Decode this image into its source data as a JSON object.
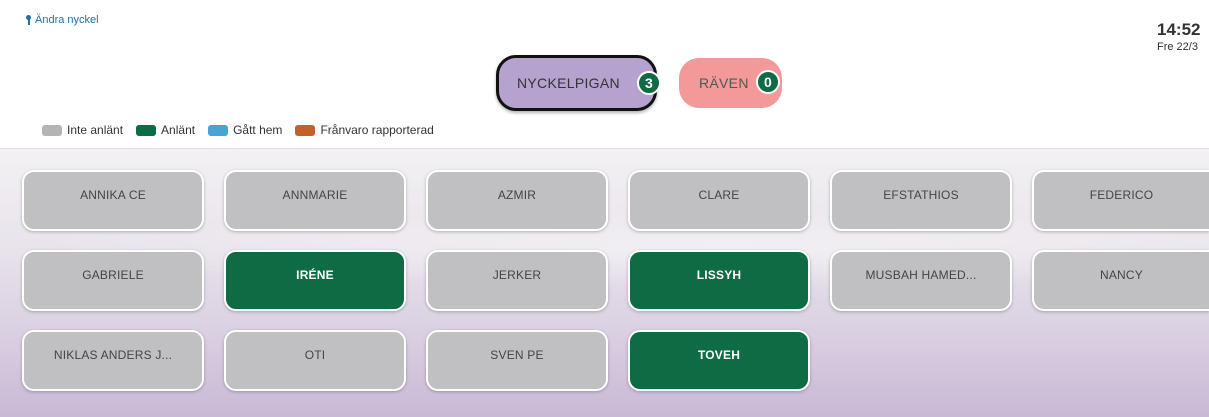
{
  "header": {
    "change_key_label": "Ändra nyckel",
    "time": "14:52",
    "date": "Fre 22/3"
  },
  "groups": [
    {
      "name": "NYCKELPIGAN",
      "count": "3",
      "selected": true,
      "color": "#b6a2cf"
    },
    {
      "name": "RÄVEN",
      "count": "0",
      "selected": false,
      "color": "#f3999a"
    }
  ],
  "legend": [
    {
      "label": "Inte anlänt",
      "color": "#b4b4b4"
    },
    {
      "label": "Anlänt",
      "color": "#0e6b44"
    },
    {
      "label": "Gått hem",
      "color": "#4aa3d1"
    },
    {
      "label": "Frånvaro rapporterad",
      "color": "#c0622a"
    }
  ],
  "people": [
    {
      "name": "ANNIKA CE",
      "status": "grey"
    },
    {
      "name": "ANNMARIE",
      "status": "grey"
    },
    {
      "name": "AZMIR",
      "status": "grey"
    },
    {
      "name": "CLARE",
      "status": "grey"
    },
    {
      "name": "EFSTATHIOS",
      "status": "grey"
    },
    {
      "name": "FEDERICO",
      "status": "grey"
    },
    {
      "name": "GABRIELE",
      "status": "grey"
    },
    {
      "name": "IRÉNE",
      "status": "green"
    },
    {
      "name": "JERKER",
      "status": "grey"
    },
    {
      "name": "LISSYH",
      "status": "green"
    },
    {
      "name": "MUSBAH HAMED...",
      "status": "grey"
    },
    {
      "name": "NANCY",
      "status": "grey"
    },
    {
      "name": "NIKLAS ANDERS J...",
      "status": "grey"
    },
    {
      "name": "OTI",
      "status": "grey"
    },
    {
      "name": "SVEN PE",
      "status": "grey"
    },
    {
      "name": "TOVEH",
      "status": "green"
    }
  ]
}
